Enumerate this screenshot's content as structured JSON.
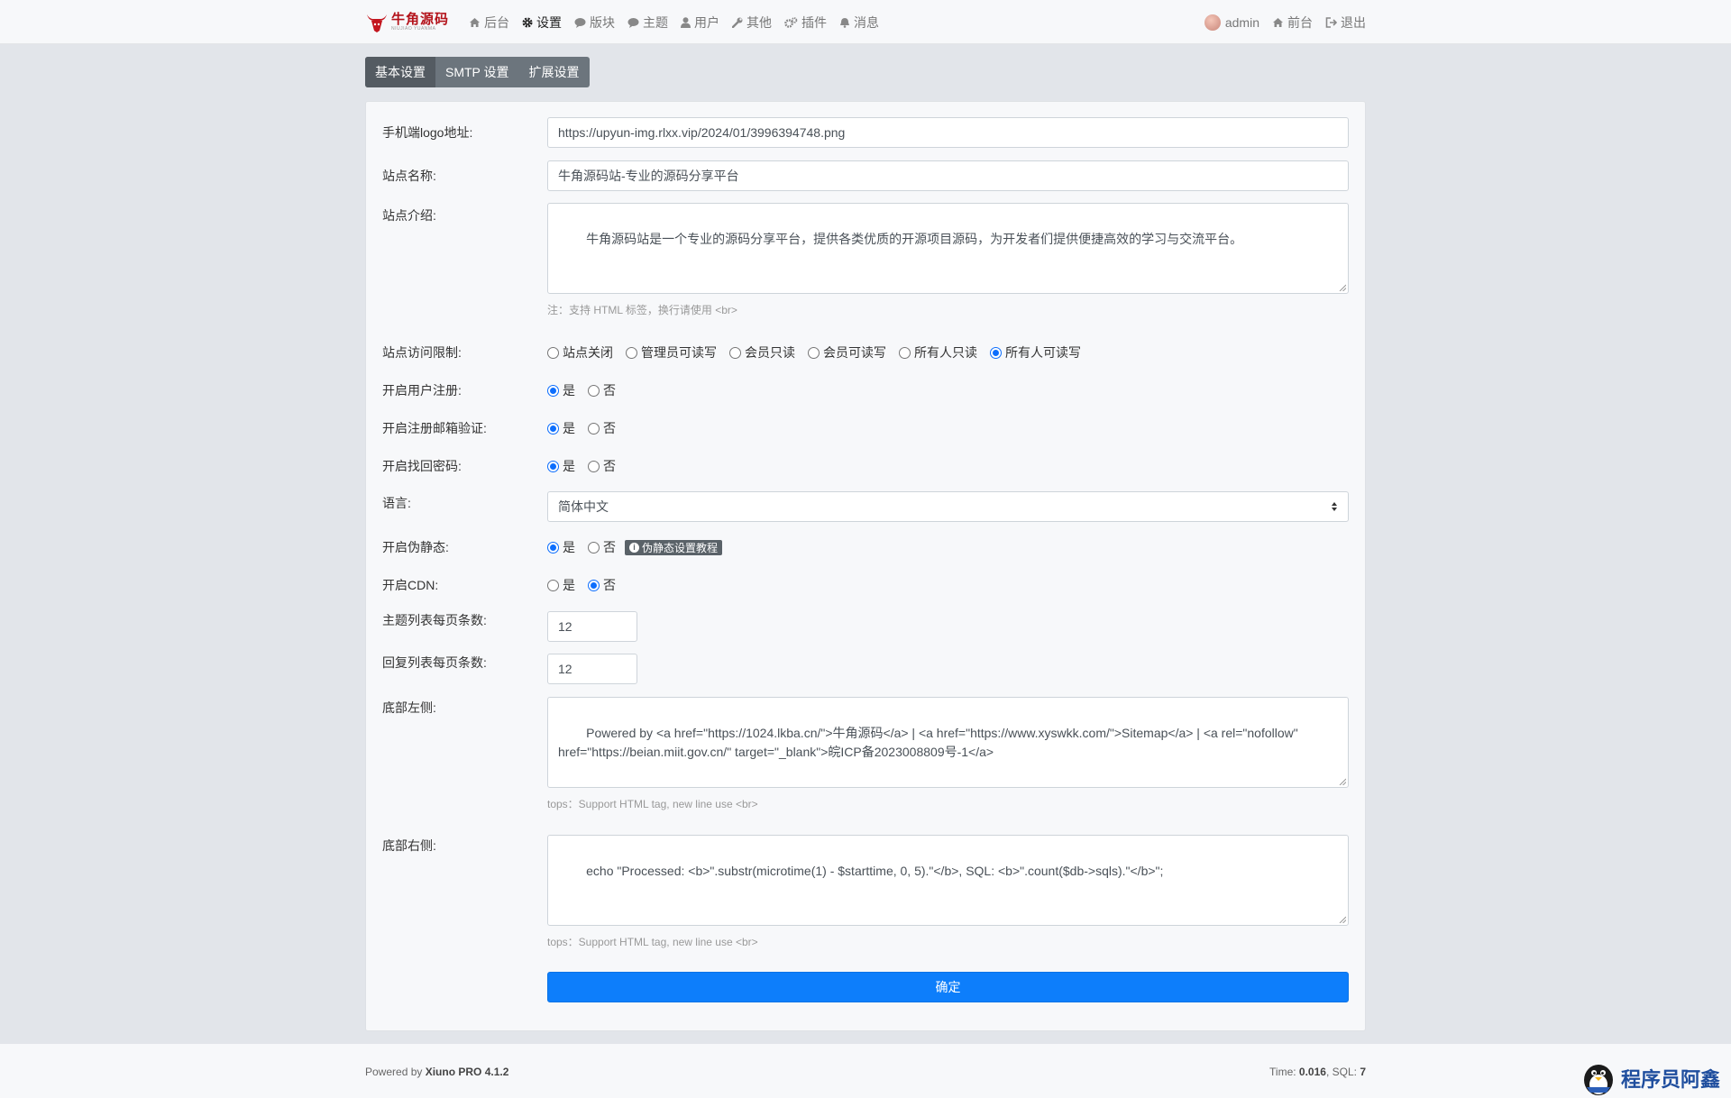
{
  "nav": {
    "logo_title": "牛角源码",
    "logo_sub": "NIUJIAO YUANMA",
    "items": [
      {
        "label": "后台",
        "icon": "home-icon"
      },
      {
        "label": "设置",
        "icon": "gear-icon",
        "active": true
      },
      {
        "label": "版块",
        "icon": "comment-icon"
      },
      {
        "label": "主题",
        "icon": "comment-icon"
      },
      {
        "label": "用户",
        "icon": "user-icon"
      },
      {
        "label": "其他",
        "icon": "wrench-icon"
      },
      {
        "label": "插件",
        "icon": "cogs-icon"
      },
      {
        "label": "消息",
        "icon": "bell-icon"
      }
    ],
    "user": "admin",
    "frontend": "前台",
    "logout": "退出"
  },
  "tabs": [
    {
      "label": "基本设置",
      "active": true
    },
    {
      "label": "SMTP 设置"
    },
    {
      "label": "扩展设置"
    }
  ],
  "form": {
    "mobile_logo": {
      "label": "手机端logo地址:",
      "value": "https://upyun-img.rlxx.vip/2024/01/3996394748.png"
    },
    "site_name": {
      "label": "站点名称:",
      "value": "牛角源码站-专业的源码分享平台"
    },
    "site_intro": {
      "label": "站点介绍:",
      "value": "牛角源码站是一个专业的源码分享平台，提供各类优质的开源项目源码，为开发者们提供便捷高效的学习与交流平台。",
      "help": "注：支持 HTML 标签，换行请使用 <br>"
    },
    "access": {
      "label": "站点访问限制:",
      "options": [
        "站点关闭",
        "管理员可读写",
        "会员只读",
        "会员可读写",
        "所有人只读",
        "所有人可读写"
      ],
      "selected": 5
    },
    "user_register": {
      "label": "开启用户注册:",
      "options": [
        "是",
        "否"
      ],
      "selected": 0
    },
    "email_verify": {
      "label": "开启注册邮箱验证:",
      "options": [
        "是",
        "否"
      ],
      "selected": 0
    },
    "find_password": {
      "label": "开启找回密码:",
      "options": [
        "是",
        "否"
      ],
      "selected": 0
    },
    "language": {
      "label": "语言:",
      "value": "简体中文"
    },
    "url_rewrite": {
      "label": "开启伪静态:",
      "options": [
        "是",
        "否"
      ],
      "selected": 0,
      "badge": "伪静态设置教程"
    },
    "cdn": {
      "label": "开启CDN:",
      "options": [
        "是",
        "否"
      ],
      "selected": 1
    },
    "thread_pagesize": {
      "label": "主题列表每页条数:",
      "value": "12"
    },
    "post_pagesize": {
      "label": "回复列表每页条数:",
      "value": "12"
    },
    "footer_left": {
      "label": "底部左侧:",
      "value": "Powered by <a href=\"https://1024.lkba.cn/\">牛角源码</a> | <a href=\"https://www.xyswkk.com/\">Sitemap</a> | <a rel=\"nofollow\" href=\"https://beian.miit.gov.cn/\" target=\"_blank\">皖ICP备2023008809号-1</a>",
      "help": "tops：Support HTML tag, new line use <br>"
    },
    "footer_right": {
      "label": "底部右侧:",
      "value": "echo \"Processed: <b>\".substr(microtime(1) - $starttime, 0, 5).\"</b>, SQL: <b>\".count($db->sqls).\"</b>\";",
      "help": "tops：Support HTML tag, new line use <br>"
    },
    "submit": "确定"
  },
  "footer": {
    "powered_prefix": "Powered by ",
    "powered_name": "Xiuno PRO 4.1.2",
    "time_prefix": "Time: ",
    "time_value": "0.016",
    "sql_prefix": ", SQL: ",
    "sql_value": "7"
  },
  "watermark": "程序员阿鑫"
}
